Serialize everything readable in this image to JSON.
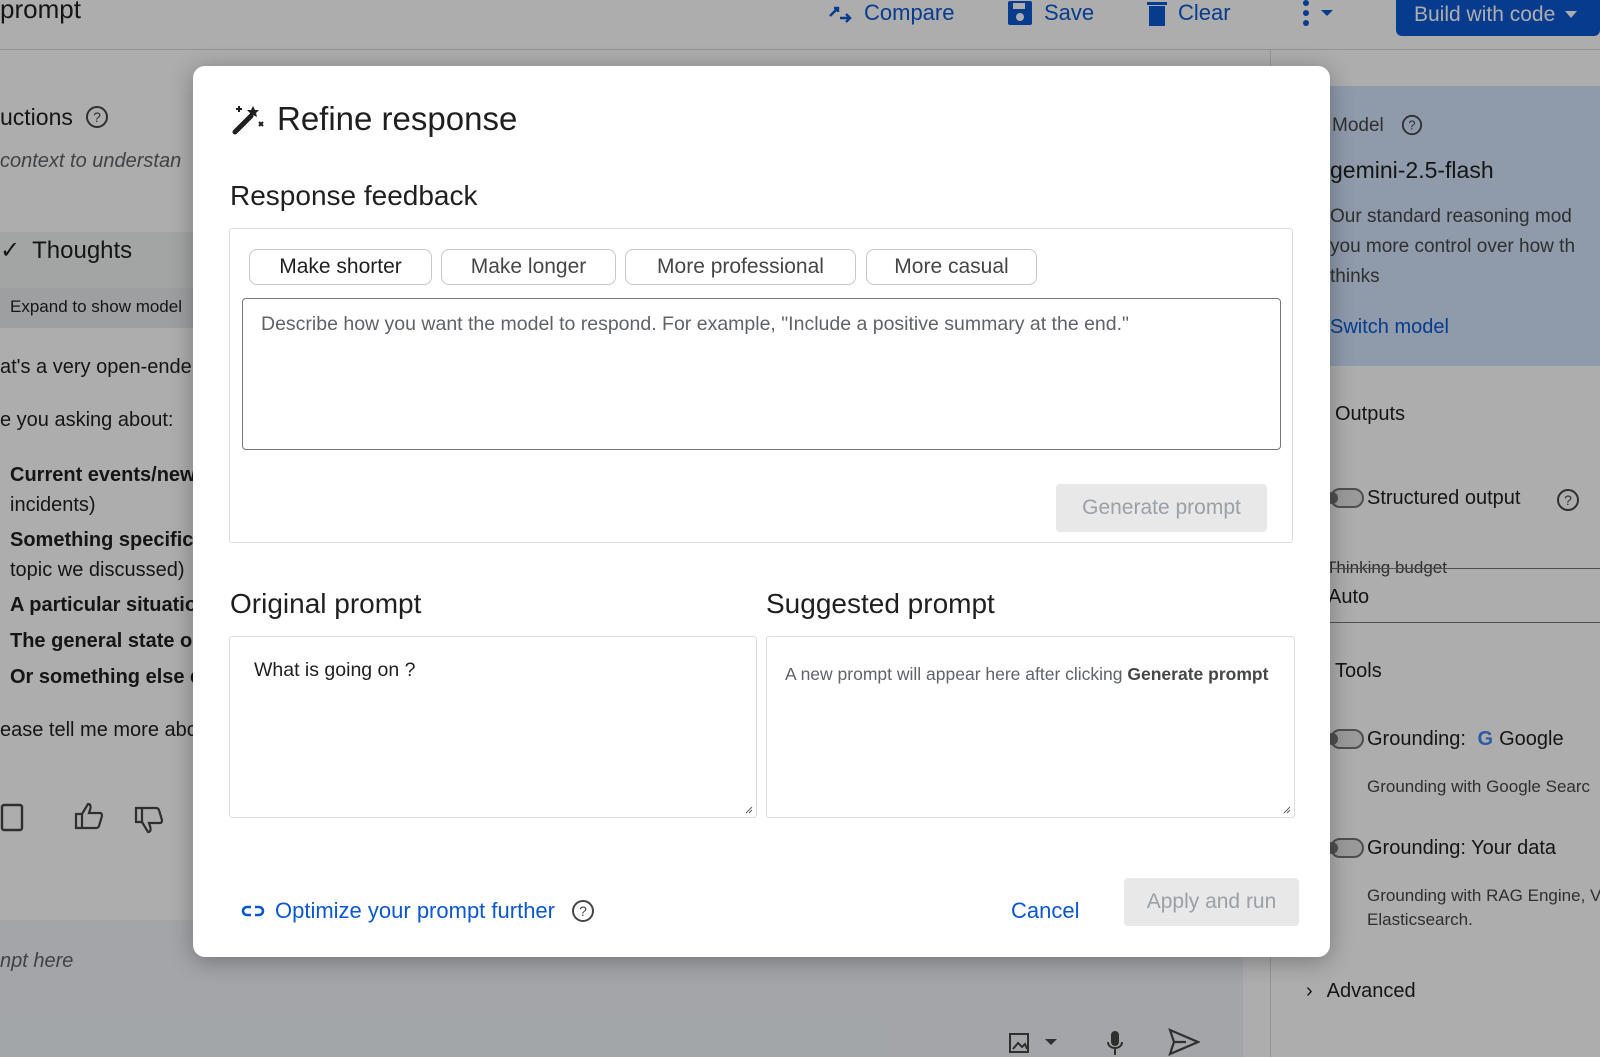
{
  "app": {
    "title": "prompt",
    "toolbar": {
      "compare_label": "Compare",
      "save_label": "Save",
      "clear_label": "Clear",
      "build_label": "Build with code"
    }
  },
  "chat": {
    "instructions_label": "uctions",
    "instructions_placeholder": "context to understan",
    "thoughts_label": "Thoughts",
    "expand_label": "Expand to show model",
    "response_lines": [
      "at's a very open-ende",
      "e you asking about:"
    ],
    "list_items": [
      {
        "bold": "Current events/new",
        "rest": "incidents)"
      },
      {
        "bold": "Something specific",
        "rest": "topic we discussed)"
      },
      {
        "bold": "A particular situatio",
        "rest": ""
      },
      {
        "bold": "The general state o",
        "rest": ""
      },
      {
        "bold": "Or something else e",
        "rest": ""
      }
    ],
    "closing_line": "ease tell me more abo",
    "input_placeholder": "npt here"
  },
  "settings": {
    "model_label": "Model",
    "model_name": "gemini-2.5-flash",
    "model_desc_lines": [
      "Our standard reasoning mod",
      "you more control over how th",
      "thinks"
    ],
    "switch_model": "Switch model",
    "outputs_label": "Outputs",
    "structured_output": "Structured output",
    "thinking_budget_label": "Thinking budget",
    "thinking_budget_value": "Auto",
    "tools_label": "Tools",
    "grounding_google": "Grounding:",
    "grounding_google_name": "Google",
    "grounding_google_desc": "Grounding with Google Searc",
    "grounding_data": "Grounding:  Your data",
    "grounding_data_desc_lines": [
      "Grounding with RAG Engine, V",
      "Elasticsearch."
    ],
    "advanced_label": "Advanced"
  },
  "dialog": {
    "title": "Refine response",
    "feedback_title": "Response feedback",
    "chips": [
      "Make shorter",
      "Make longer",
      "More professional",
      "More casual"
    ],
    "feedback_placeholder": "Describe how you want the model to respond. For example, \"Include a positive summary at the end.\"",
    "generate_label": "Generate prompt",
    "original_title": "Original prompt",
    "original_value": "What is going on ?",
    "suggested_title": "Suggested prompt",
    "suggested_hint": "A new prompt will appear here after clicking ",
    "suggested_hint_bold": "Generate prompt",
    "optimize_label": "Optimize your prompt further",
    "cancel_label": "Cancel",
    "apply_label": "Apply and run"
  },
  "colors": {
    "accent": "#0b57d0",
    "scrim": "rgba(0,0,0,0.32)",
    "model_card": "#d3e3fd"
  }
}
